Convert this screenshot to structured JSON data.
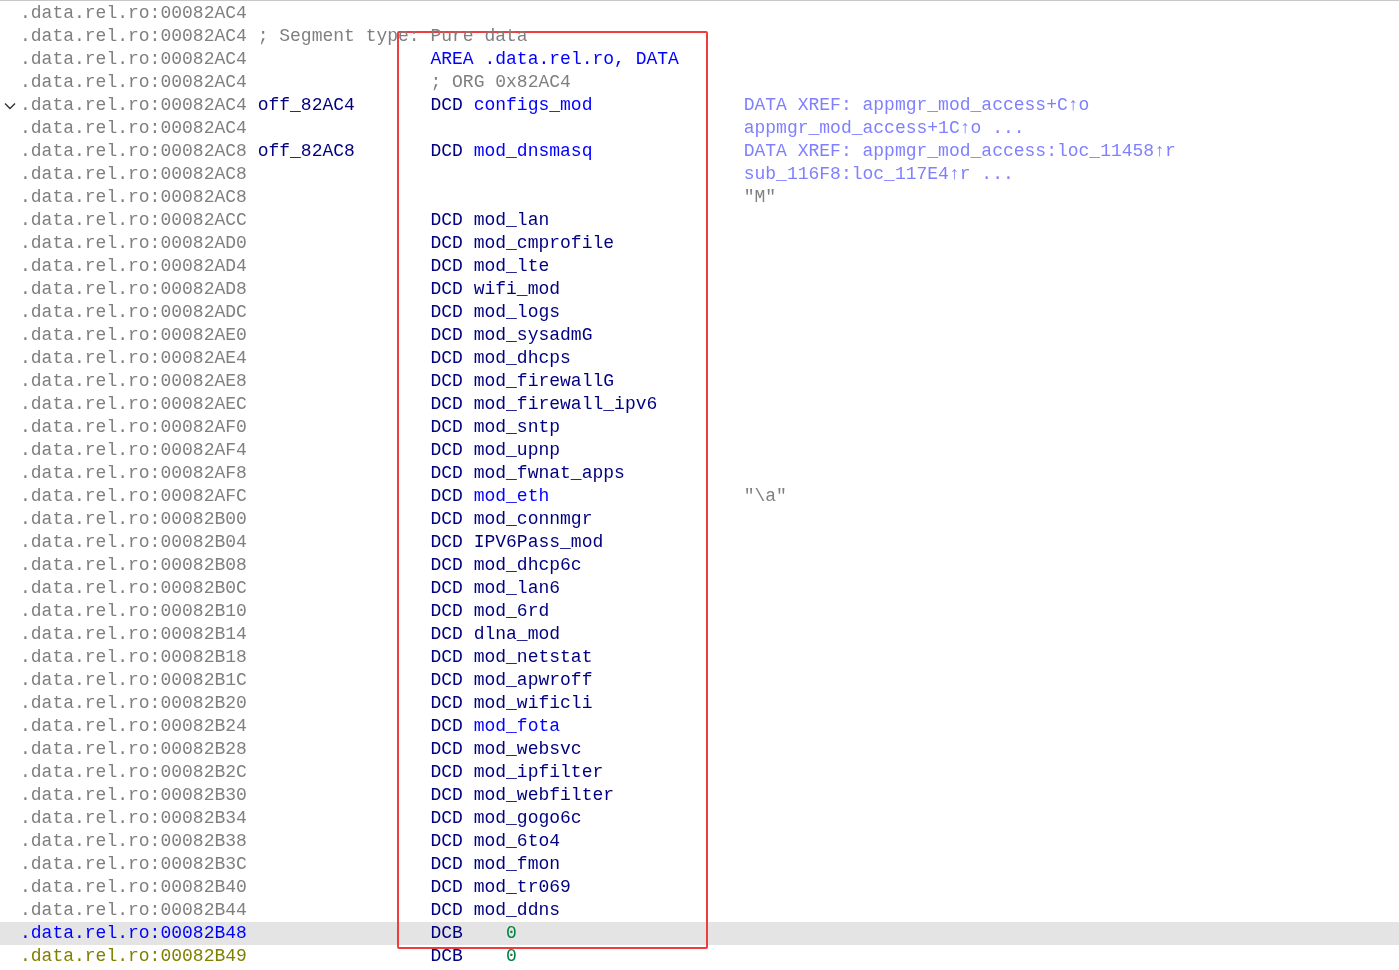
{
  "lines": [
    {
      "address": {
        "text": ".data.rel.ro:00082AC4",
        "kind": "normal"
      },
      "selected": false,
      "kind": "blank",
      "collapsible": false
    },
    {
      "address": {
        "text": ".data.rel.ro:00082AC4",
        "kind": "normal"
      },
      "selected": false,
      "kind": "comment",
      "text": "; Segment type: Pure data",
      "collapsible": false
    },
    {
      "address": {
        "text": ".data.rel.ro:00082AC4",
        "kind": "normal"
      },
      "selected": false,
      "kind": "directive",
      "text": "AREA .data.rel.ro, DATA",
      "collapsible": false
    },
    {
      "address": {
        "text": ".data.rel.ro:00082AC4",
        "kind": "normal"
      },
      "selected": false,
      "kind": "org",
      "text": "; ORG 0x82AC4",
      "collapsible": false
    },
    {
      "address": {
        "text": ".data.rel.ro:00082AC4",
        "kind": "normal"
      },
      "selected": false,
      "kind": "data",
      "label": "off_82AC4",
      "mnemonic": "DCD",
      "operand": {
        "text": "configs_mod",
        "kind": "link"
      },
      "comment": {
        "text": "DATA XREF: appmgr_mod_access+C↑o",
        "kind": "xref"
      },
      "collapsible": true
    },
    {
      "address": {
        "text": ".data.rel.ro:00082AC4",
        "kind": "normal"
      },
      "selected": false,
      "kind": "blank",
      "comment": {
        "text": "appmgr_mod_access+1C↑o ...",
        "kind": "xref"
      },
      "collapsible": false
    },
    {
      "address": {
        "text": ".data.rel.ro:00082AC8",
        "kind": "normal"
      },
      "selected": false,
      "kind": "data",
      "label": "off_82AC8",
      "mnemonic": "DCD",
      "operand": {
        "text": "mod_dnsmasq",
        "kind": "link"
      },
      "comment": {
        "text": "DATA XREF: appmgr_mod_access:loc_11458↑r",
        "kind": "xref"
      },
      "collapsible": false
    },
    {
      "address": {
        "text": ".data.rel.ro:00082AC8",
        "kind": "normal"
      },
      "selected": false,
      "kind": "blank",
      "comment": {
        "text": "sub_116F8:loc_117E4↑r ...",
        "kind": "xref"
      },
      "collapsible": false
    },
    {
      "address": {
        "text": ".data.rel.ro:00082AC8",
        "kind": "normal"
      },
      "selected": false,
      "kind": "blank",
      "comment": {
        "text": "\"M\"",
        "kind": "string"
      },
      "collapsible": false
    },
    {
      "address": {
        "text": ".data.rel.ro:00082ACC",
        "kind": "normal"
      },
      "selected": false,
      "kind": "data",
      "mnemonic": "DCD",
      "operand": {
        "text": "mod_lan",
        "kind": "name"
      },
      "collapsible": false
    },
    {
      "address": {
        "text": ".data.rel.ro:00082AD0",
        "kind": "normal"
      },
      "selected": false,
      "kind": "data",
      "mnemonic": "DCD",
      "operand": {
        "text": "mod_cmprofile",
        "kind": "name"
      },
      "collapsible": false
    },
    {
      "address": {
        "text": ".data.rel.ro:00082AD4",
        "kind": "normal"
      },
      "selected": false,
      "kind": "data",
      "mnemonic": "DCD",
      "operand": {
        "text": "mod_lte",
        "kind": "name"
      },
      "collapsible": false
    },
    {
      "address": {
        "text": ".data.rel.ro:00082AD8",
        "kind": "normal"
      },
      "selected": false,
      "kind": "data",
      "mnemonic": "DCD",
      "operand": {
        "text": "wifi_mod",
        "kind": "name"
      },
      "collapsible": false
    },
    {
      "address": {
        "text": ".data.rel.ro:00082ADC",
        "kind": "normal"
      },
      "selected": false,
      "kind": "data",
      "mnemonic": "DCD",
      "operand": {
        "text": "mod_logs",
        "kind": "name"
      },
      "collapsible": false
    },
    {
      "address": {
        "text": ".data.rel.ro:00082AE0",
        "kind": "normal"
      },
      "selected": false,
      "kind": "data",
      "mnemonic": "DCD",
      "operand": {
        "text": "mod_sysadmG",
        "kind": "name"
      },
      "collapsible": false
    },
    {
      "address": {
        "text": ".data.rel.ro:00082AE4",
        "kind": "normal"
      },
      "selected": false,
      "kind": "data",
      "mnemonic": "DCD",
      "operand": {
        "text": "mod_dhcps",
        "kind": "name"
      },
      "collapsible": false
    },
    {
      "address": {
        "text": ".data.rel.ro:00082AE8",
        "kind": "normal"
      },
      "selected": false,
      "kind": "data",
      "mnemonic": "DCD",
      "operand": {
        "text": "mod_firewallG",
        "kind": "name"
      },
      "collapsible": false
    },
    {
      "address": {
        "text": ".data.rel.ro:00082AEC",
        "kind": "normal"
      },
      "selected": false,
      "kind": "data",
      "mnemonic": "DCD",
      "operand": {
        "text": "mod_firewall_ipv6",
        "kind": "name"
      },
      "collapsible": false
    },
    {
      "address": {
        "text": ".data.rel.ro:00082AF0",
        "kind": "normal"
      },
      "selected": false,
      "kind": "data",
      "mnemonic": "DCD",
      "operand": {
        "text": "mod_sntp",
        "kind": "name"
      },
      "collapsible": false
    },
    {
      "address": {
        "text": ".data.rel.ro:00082AF4",
        "kind": "normal"
      },
      "selected": false,
      "kind": "data",
      "mnemonic": "DCD",
      "operand": {
        "text": "mod_upnp",
        "kind": "name"
      },
      "collapsible": false
    },
    {
      "address": {
        "text": ".data.rel.ro:00082AF8",
        "kind": "normal"
      },
      "selected": false,
      "kind": "data",
      "mnemonic": "DCD",
      "operand": {
        "text": "mod_fwnat_apps",
        "kind": "name"
      },
      "collapsible": false
    },
    {
      "address": {
        "text": ".data.rel.ro:00082AFC",
        "kind": "normal"
      },
      "selected": false,
      "kind": "data",
      "mnemonic": "DCD",
      "operand": {
        "text": "mod_eth",
        "kind": "link"
      },
      "comment": {
        "text": "\"\\a\"",
        "kind": "string"
      },
      "collapsible": false
    },
    {
      "address": {
        "text": ".data.rel.ro:00082B00",
        "kind": "normal"
      },
      "selected": false,
      "kind": "data",
      "mnemonic": "DCD",
      "operand": {
        "text": "mod_connmgr",
        "kind": "name"
      },
      "collapsible": false
    },
    {
      "address": {
        "text": ".data.rel.ro:00082B04",
        "kind": "normal"
      },
      "selected": false,
      "kind": "data",
      "mnemonic": "DCD",
      "operand": {
        "text": "IPV6Pass_mod",
        "kind": "name"
      },
      "collapsible": false
    },
    {
      "address": {
        "text": ".data.rel.ro:00082B08",
        "kind": "normal"
      },
      "selected": false,
      "kind": "data",
      "mnemonic": "DCD",
      "operand": {
        "text": "mod_dhcp6c",
        "kind": "name"
      },
      "collapsible": false
    },
    {
      "address": {
        "text": ".data.rel.ro:00082B0C",
        "kind": "normal"
      },
      "selected": false,
      "kind": "data",
      "mnemonic": "DCD",
      "operand": {
        "text": "mod_lan6",
        "kind": "name"
      },
      "collapsible": false
    },
    {
      "address": {
        "text": ".data.rel.ro:00082B10",
        "kind": "normal"
      },
      "selected": false,
      "kind": "data",
      "mnemonic": "DCD",
      "operand": {
        "text": "mod_6rd",
        "kind": "name"
      },
      "collapsible": false
    },
    {
      "address": {
        "text": ".data.rel.ro:00082B14",
        "kind": "normal"
      },
      "selected": false,
      "kind": "data",
      "mnemonic": "DCD",
      "operand": {
        "text": "dlna_mod",
        "kind": "name"
      },
      "collapsible": false
    },
    {
      "address": {
        "text": ".data.rel.ro:00082B18",
        "kind": "normal"
      },
      "selected": false,
      "kind": "data",
      "mnemonic": "DCD",
      "operand": {
        "text": "mod_netstat",
        "kind": "name"
      },
      "collapsible": false
    },
    {
      "address": {
        "text": ".data.rel.ro:00082B1C",
        "kind": "normal"
      },
      "selected": false,
      "kind": "data",
      "mnemonic": "DCD",
      "operand": {
        "text": "mod_apwroff",
        "kind": "name"
      },
      "collapsible": false
    },
    {
      "address": {
        "text": ".data.rel.ro:00082B20",
        "kind": "normal"
      },
      "selected": false,
      "kind": "data",
      "mnemonic": "DCD",
      "operand": {
        "text": "mod_wificli",
        "kind": "name"
      },
      "collapsible": false
    },
    {
      "address": {
        "text": ".data.rel.ro:00082B24",
        "kind": "normal"
      },
      "selected": false,
      "kind": "data",
      "mnemonic": "DCD",
      "operand": {
        "text": "mod_fota",
        "kind": "link"
      },
      "collapsible": false
    },
    {
      "address": {
        "text": ".data.rel.ro:00082B28",
        "kind": "normal"
      },
      "selected": false,
      "kind": "data",
      "mnemonic": "DCD",
      "operand": {
        "text": "mod_websvc",
        "kind": "name"
      },
      "collapsible": false
    },
    {
      "address": {
        "text": ".data.rel.ro:00082B2C",
        "kind": "normal"
      },
      "selected": false,
      "kind": "data",
      "mnemonic": "DCD",
      "operand": {
        "text": "mod_ipfilter",
        "kind": "name"
      },
      "collapsible": false
    },
    {
      "address": {
        "text": ".data.rel.ro:00082B30",
        "kind": "normal"
      },
      "selected": false,
      "kind": "data",
      "mnemonic": "DCD",
      "operand": {
        "text": "mod_webfilter",
        "kind": "name"
      },
      "collapsible": false
    },
    {
      "address": {
        "text": ".data.rel.ro:00082B34",
        "kind": "normal"
      },
      "selected": false,
      "kind": "data",
      "mnemonic": "DCD",
      "operand": {
        "text": "mod_gogo6c",
        "kind": "name"
      },
      "collapsible": false
    },
    {
      "address": {
        "text": ".data.rel.ro:00082B38",
        "kind": "normal"
      },
      "selected": false,
      "kind": "data",
      "mnemonic": "DCD",
      "operand": {
        "text": "mod_6to4",
        "kind": "name"
      },
      "collapsible": false
    },
    {
      "address": {
        "text": ".data.rel.ro:00082B3C",
        "kind": "normal"
      },
      "selected": false,
      "kind": "data",
      "mnemonic": "DCD",
      "operand": {
        "text": "mod_fmon",
        "kind": "name"
      },
      "collapsible": false
    },
    {
      "address": {
        "text": ".data.rel.ro:00082B40",
        "kind": "normal"
      },
      "selected": false,
      "kind": "data",
      "mnemonic": "DCD",
      "operand": {
        "text": "mod_tr069",
        "kind": "name"
      },
      "collapsible": false
    },
    {
      "address": {
        "text": ".data.rel.ro:00082B44",
        "kind": "normal"
      },
      "selected": false,
      "kind": "data",
      "mnemonic": "DCD",
      "operand": {
        "text": "mod_ddns",
        "kind": "name"
      },
      "collapsible": false
    },
    {
      "address": {
        "text": ".data.rel.ro:00082B48",
        "kind": "normal"
      },
      "selected": true,
      "kind": "data",
      "mnemonic": "DCB",
      "operand": {
        "text": "0",
        "kind": "number"
      },
      "collapsible": false
    },
    {
      "address": {
        "text": ".data.rel.ro:00082B49",
        "kind": "unexplored"
      },
      "selected": false,
      "kind": "data",
      "mnemonic": "DCB",
      "operand": {
        "text": "0",
        "kind": "number"
      },
      "collapsible": false
    }
  ]
}
